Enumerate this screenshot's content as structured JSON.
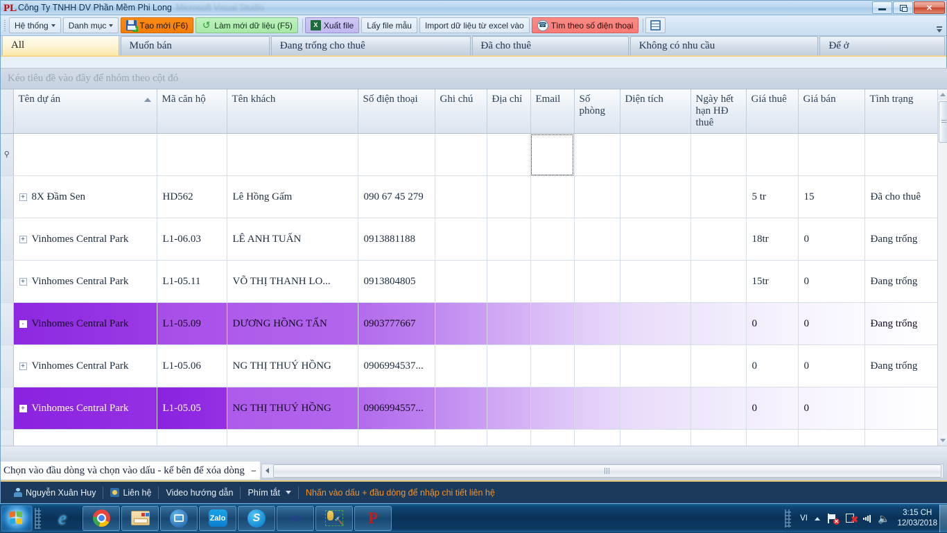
{
  "window": {
    "title": "Công Ty TNHH DV Phần Mềm Phi Long",
    "ghost_title": "Microsoft Visual Studio",
    "app_icon": "PL",
    "minimize": "minimize-icon",
    "maximize": "restore-icon",
    "close": "✕"
  },
  "toolbar": {
    "buttons": [
      {
        "label": "Hệ thống",
        "style": "plain",
        "icon": "",
        "caret": true
      },
      {
        "label": "Danh mục",
        "style": "plain",
        "icon": "",
        "caret": true
      },
      {
        "label": "Tạo mới (F6)",
        "style": "orange",
        "icon": "save-new-icon",
        "caret": false
      },
      {
        "label": "Làm mới dữ liệu (F5)",
        "style": "green",
        "icon": "refresh-icon",
        "caret": false
      },
      {
        "label": "Xuất file",
        "style": "lav",
        "icon": "excel-export-icon",
        "caret": false
      },
      {
        "label": "Lấy file mẫu",
        "style": "plain",
        "icon": "",
        "caret": false
      },
      {
        "label": "Import dữ liệu từ excel vào",
        "style": "plain",
        "icon": "",
        "caret": false
      },
      {
        "label": "Tìm theo số điện thoại",
        "style": "red",
        "icon": "phone-search-icon",
        "caret": false
      }
    ],
    "extra_button_icon": "grid-export-icon",
    "overflow": "toolbar-overflow-icon"
  },
  "tabs": [
    {
      "label": "All",
      "active": true
    },
    {
      "label": "Muốn bán",
      "active": false
    },
    {
      "label": "Đang trống cho thuê",
      "active": false
    },
    {
      "label": "Đã cho thuê",
      "active": false
    },
    {
      "label": "Không có nhu cầu",
      "active": false
    },
    {
      "label": "Để ở",
      "active": false
    }
  ],
  "grid": {
    "group_panel_text": "Kéo tiêu đề vào đây để nhóm theo cột đó",
    "columns": [
      {
        "label": "Tên dự án",
        "sorted": true
      },
      {
        "label": "Mã căn hộ",
        "sorted": false
      },
      {
        "label": "Tên khách",
        "sorted": false
      },
      {
        "label": "Số điện thoại",
        "sorted": false
      },
      {
        "label": "Ghi chú",
        "sorted": false
      },
      {
        "label": "Địa chỉ",
        "sorted": false
      },
      {
        "label": "Email",
        "sorted": false
      },
      {
        "label": "Số phòng",
        "sorted": false
      },
      {
        "label": "Diện tích",
        "sorted": false
      },
      {
        "label": "Ngày hết hạn HĐ thuê",
        "sorted": false
      },
      {
        "label": "Giá thuê",
        "sorted": false
      },
      {
        "label": "Giá bán",
        "sorted": false
      },
      {
        "label": "Tình trạng",
        "sorted": false
      }
    ],
    "filter_row": {
      "focused_column": "Email",
      "values": [
        "",
        "",
        "",
        "",
        "",
        "",
        "",
        "",
        "",
        "",
        "",
        "",
        ""
      ]
    },
    "rows": [
      {
        "selected": false,
        "expander": "+",
        "cells": [
          "8X Đầm Sen",
          "HD562",
          "Lê Hồng Gấm",
          "090 67 45 279",
          "",
          "",
          "",
          "",
          "",
          "",
          "5 tr",
          "15",
          "Đã cho thuê"
        ]
      },
      {
        "selected": false,
        "expander": "+",
        "cells": [
          "Vinhomes Central Park",
          "L1-06.03",
          "LÊ ANH TUẤN",
          "0913881188",
          "",
          "",
          "",
          "",
          "",
          "",
          "18tr",
          "0",
          "Đang trống"
        ]
      },
      {
        "selected": false,
        "expander": "+",
        "cells": [
          "Vinhomes Central Park",
          "L1-05.11",
          "VÕ THỊ THANH LO...",
          "0913804805",
          "",
          "",
          "",
          "",
          "",
          "",
          "15tr",
          "0",
          "Đang trống"
        ]
      },
      {
        "selected": true,
        "expander": "-",
        "cells": [
          "Vinhomes Central Park",
          "L1-05.09",
          "DƯƠNG HỒNG TẤN",
          "0903777667",
          "",
          "",
          "",
          "",
          "",
          "",
          "0",
          "0",
          "Đang trống"
        ]
      },
      {
        "selected": false,
        "expander": "+",
        "cells": [
          "Vinhomes Central Park",
          "L1-05.06",
          "NG THỊ THUÝ HỒNG",
          "0906994537...",
          "",
          "",
          "",
          "",
          "",
          "",
          "0",
          "0",
          "Đang trống"
        ]
      },
      {
        "selected": true,
        "expander": "+",
        "cells": [
          "Vinhomes Central Park",
          "L1-05.05",
          "NG THỊ THUÝ HỒNG",
          "0906994557...",
          "",
          "",
          "",
          "",
          "",
          "",
          "0",
          "0",
          ""
        ]
      }
    ]
  },
  "hint": {
    "text": "Chọn vào đầu dòng và chọn vào dấu - kế bên để xóa dòng",
    "minus_label": "−"
  },
  "app_bottom": {
    "user": "Nguyễn Xuân Huy",
    "contact": "Liên hệ",
    "video": "Video hướng dẫn",
    "shortcut": "Phím tắt",
    "note": "Nhấn vào dấu + đầu dòng để nhập chi tiết liên hệ"
  },
  "taskbar": {
    "start": "start-orb-icon",
    "apps": [
      {
        "name": "internet-explorer-icon",
        "glyph": "e"
      },
      {
        "name": "google-chrome-icon",
        "glyph": ""
      },
      {
        "name": "file-explorer-icon",
        "glyph": ""
      },
      {
        "name": "media-app-icon",
        "glyph": ""
      },
      {
        "name": "zalo-icon",
        "glyph": "Zalo"
      },
      {
        "name": "skype-icon",
        "glyph": "S"
      },
      {
        "name": "unikey-icon",
        "glyph": "∞"
      },
      {
        "name": "dev-tools-icon",
        "glyph": ""
      },
      {
        "name": "phi-long-app-icon",
        "glyph": "P"
      }
    ],
    "tray": {
      "input_lang": "VI",
      "time": "3:15 CH",
      "date": "12/03/2018"
    }
  },
  "colors": {
    "accent_orange": "#f47c04",
    "accent_green": "#a9e8a9",
    "accent_red": "#f97a74",
    "selection_purple": "#8d28e0",
    "tab_active": "#fbe9a8",
    "note_orange": "#f0922a"
  }
}
